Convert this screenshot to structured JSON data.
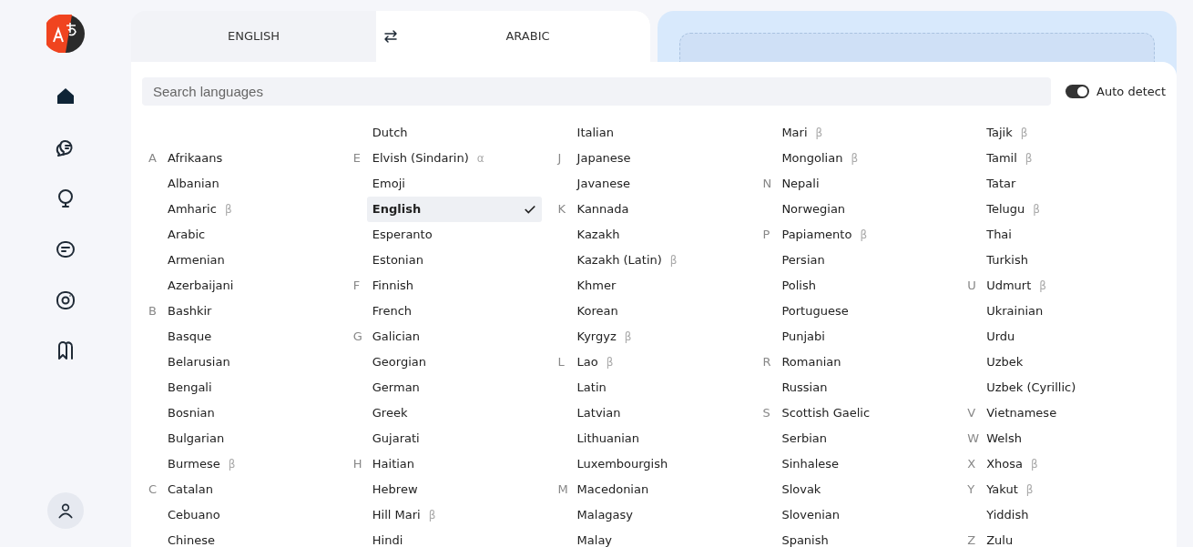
{
  "tabs": [
    {
      "label": "ENGLISH",
      "selected": false
    },
    {
      "label": "ARABIC",
      "selected": true
    }
  ],
  "search": {
    "placeholder": "Search languages"
  },
  "auto_detect": {
    "label": "Auto detect",
    "on": true
  },
  "columns": [
    [
      {
        "letter": "A",
        "name": "Afrikaans",
        "selected": false
      },
      {
        "name": "Albanian",
        "selected": false
      },
      {
        "name": "Amharic",
        "tag": "β",
        "selected": false
      },
      {
        "name": "Arabic",
        "selected": false
      },
      {
        "name": "Armenian",
        "selected": false
      },
      {
        "name": "Azerbaijani",
        "selected": false
      },
      {
        "letter": "B",
        "name": "Bashkir",
        "selected": false
      },
      {
        "name": "Basque",
        "selected": false
      },
      {
        "name": "Belarusian",
        "selected": false
      },
      {
        "name": "Bengali",
        "selected": false
      },
      {
        "name": "Bosnian",
        "selected": false
      },
      {
        "name": "Bulgarian",
        "selected": false
      },
      {
        "name": "Burmese",
        "tag": "β",
        "selected": false
      },
      {
        "letter": "C",
        "name": "Catalan",
        "selected": false
      },
      {
        "name": "Cebuano",
        "selected": false
      },
      {
        "name": "Chinese",
        "selected": false
      }
    ],
    [
      {
        "name": "Dutch",
        "selected": false
      },
      {
        "letter": "E",
        "name": "Elvish (Sindarin)",
        "tag": "α",
        "selected": false
      },
      {
        "name": "Emoji",
        "selected": false
      },
      {
        "name": "English",
        "selected": true
      },
      {
        "name": "Esperanto",
        "selected": false
      },
      {
        "name": "Estonian",
        "selected": false
      },
      {
        "letter": "F",
        "name": "Finnish",
        "selected": false
      },
      {
        "name": "French",
        "selected": false
      },
      {
        "letter": "G",
        "name": "Galician",
        "selected": false
      },
      {
        "name": "Georgian",
        "selected": false
      },
      {
        "name": "German",
        "selected": false
      },
      {
        "name": "Greek",
        "selected": false
      },
      {
        "name": "Gujarati",
        "selected": false
      },
      {
        "letter": "H",
        "name": "Haitian",
        "selected": false
      },
      {
        "name": "Hebrew",
        "selected": false
      },
      {
        "name": "Hill Mari",
        "tag": "β",
        "selected": false
      },
      {
        "name": "Hindi",
        "selected": false
      }
    ],
    [
      {
        "name": "Italian",
        "selected": false
      },
      {
        "letter": "J",
        "name": "Japanese",
        "selected": false
      },
      {
        "name": "Javanese",
        "selected": false
      },
      {
        "letter": "K",
        "name": "Kannada",
        "selected": false
      },
      {
        "name": "Kazakh",
        "selected": false
      },
      {
        "name": "Kazakh (Latin)",
        "tag": "β",
        "selected": false
      },
      {
        "name": "Khmer",
        "selected": false
      },
      {
        "name": "Korean",
        "selected": false
      },
      {
        "name": "Kyrgyz",
        "tag": "β",
        "selected": false
      },
      {
        "letter": "L",
        "name": "Lao",
        "tag": "β",
        "selected": false
      },
      {
        "name": "Latin",
        "selected": false
      },
      {
        "name": "Latvian",
        "selected": false
      },
      {
        "name": "Lithuanian",
        "selected": false
      },
      {
        "name": "Luxembourgish",
        "selected": false
      },
      {
        "letter": "M",
        "name": "Macedonian",
        "selected": false
      },
      {
        "name": "Malagasy",
        "selected": false
      },
      {
        "name": "Malay",
        "selected": false
      }
    ],
    [
      {
        "name": "Mari",
        "tag": "β",
        "selected": false
      },
      {
        "name": "Mongolian",
        "tag": "β",
        "selected": false
      },
      {
        "letter": "N",
        "name": "Nepali",
        "selected": false
      },
      {
        "name": "Norwegian",
        "selected": false
      },
      {
        "letter": "P",
        "name": "Papiamento",
        "tag": "β",
        "selected": false
      },
      {
        "name": "Persian",
        "selected": false
      },
      {
        "name": "Polish",
        "selected": false
      },
      {
        "name": "Portuguese",
        "selected": false
      },
      {
        "name": "Punjabi",
        "selected": false
      },
      {
        "letter": "R",
        "name": "Romanian",
        "selected": false
      },
      {
        "name": "Russian",
        "selected": false
      },
      {
        "letter": "S",
        "name": "Scottish Gaelic",
        "selected": false
      },
      {
        "name": "Serbian",
        "selected": false
      },
      {
        "name": "Sinhalese",
        "selected": false
      },
      {
        "name": "Slovak",
        "selected": false
      },
      {
        "name": "Slovenian",
        "selected": false
      },
      {
        "name": "Spanish",
        "selected": false
      }
    ],
    [
      {
        "name": "Tajik",
        "tag": "β",
        "selected": false
      },
      {
        "name": "Tamil",
        "tag": "β",
        "selected": false
      },
      {
        "name": "Tatar",
        "selected": false
      },
      {
        "name": "Telugu",
        "tag": "β",
        "selected": false
      },
      {
        "name": "Thai",
        "selected": false
      },
      {
        "name": "Turkish",
        "selected": false
      },
      {
        "letter": "U",
        "name": "Udmurt",
        "tag": "β",
        "selected": false
      },
      {
        "name": "Ukrainian",
        "selected": false
      },
      {
        "name": "Urdu",
        "selected": false
      },
      {
        "name": "Uzbek",
        "selected": false
      },
      {
        "name": "Uzbek (Cyrillic)",
        "selected": false
      },
      {
        "letter": "V",
        "name": "Vietnamese",
        "selected": false
      },
      {
        "letter": "W",
        "name": "Welsh",
        "selected": false
      },
      {
        "letter": "X",
        "name": "Xhosa",
        "tag": "β",
        "selected": false
      },
      {
        "letter": "Y",
        "name": "Yakut",
        "tag": "β",
        "selected": false
      },
      {
        "name": "Yiddish",
        "selected": false
      },
      {
        "letter": "Z",
        "name": "Zulu",
        "selected": false
      }
    ]
  ]
}
